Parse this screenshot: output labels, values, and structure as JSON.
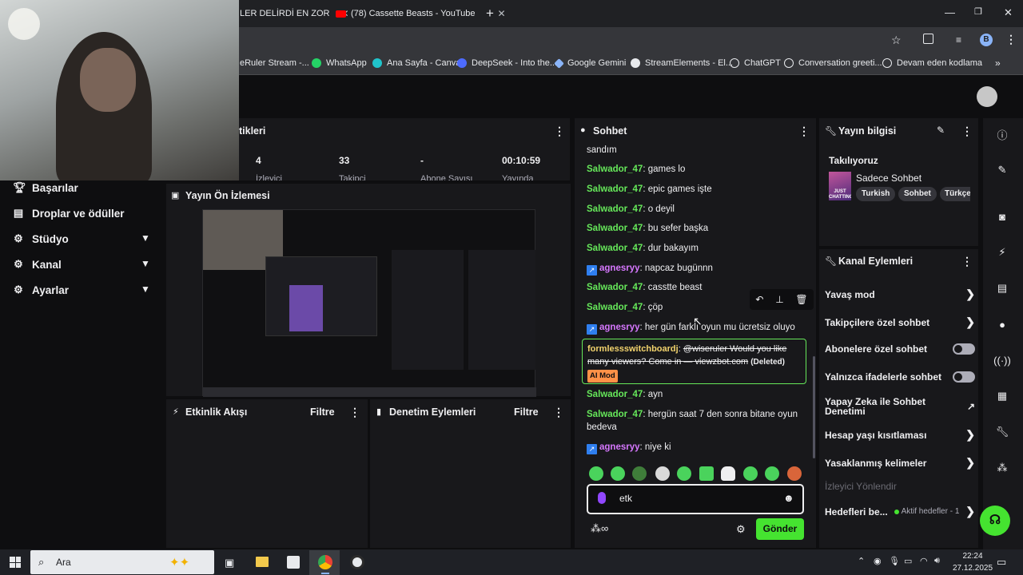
{
  "browser": {
    "tabs": [
      {
        "title": "LER DELİRDİ EN ZOR"
      },
      {
        "title": "(78) Cassette Beasts - YouTube"
      }
    ],
    "new_tab": "+",
    "bookmarks": [
      {
        "label": "eRuler Stream -..."
      },
      {
        "label": "WhatsApp"
      },
      {
        "label": "Ana Sayfa - Canva"
      },
      {
        "label": "DeepSeek - Into the..."
      },
      {
        "label": "Google Gemini"
      },
      {
        "label": "StreamElements - El..."
      },
      {
        "label": "ChatGPT"
      },
      {
        "label": "Conversation greeti..."
      },
      {
        "label": "Devam eden kodlama"
      }
    ],
    "profile_initial": "B"
  },
  "stats": {
    "title": "tikleri",
    "items": [
      {
        "value": "4",
        "label": "İzleyici"
      },
      {
        "value": "33",
        "label": "Takipçi"
      },
      {
        "value": "-",
        "label": "Abone Sayısı"
      },
      {
        "value": "00:10:59",
        "label": "Yayında"
      }
    ]
  },
  "nav": {
    "items": [
      {
        "label": "Başarılar",
        "icon": "trophy-icon"
      },
      {
        "label": "Droplar ve ödüller",
        "icon": "drops-icon"
      },
      {
        "label": "Stüdyo",
        "icon": "gear-icon"
      },
      {
        "label": "Kanal",
        "icon": "gear-icon"
      },
      {
        "label": "Ayarlar",
        "icon": "gear-icon"
      }
    ]
  },
  "preview": {
    "title": "Yayın Ön İzlemesi"
  },
  "activity": {
    "title": "Etkinlik Akışı",
    "filter": "Filtre"
  },
  "moderation": {
    "title": "Denetim Eylemleri",
    "filter": "Filtre"
  },
  "chat": {
    "title": "Sohbet",
    "messages": [
      {
        "user": "",
        "text": "sandım"
      },
      {
        "user": "Salwador_47",
        "text": "games lo"
      },
      {
        "user": "Salwador_47",
        "text": "epic games işte"
      },
      {
        "user": "Salwador_47",
        "text": "o deyil"
      },
      {
        "user": "Salwador_47",
        "text": "bu sefer başka"
      },
      {
        "user": "Salwador_47",
        "text": "dur bakayım"
      },
      {
        "user": "agnesryy",
        "text": "napcaz bugünnn"
      },
      {
        "user": "Salwador_47",
        "text": "casstte beast"
      },
      {
        "user": "Salwador_47",
        "text": "çöp"
      },
      {
        "user": "agnesryy",
        "text": "her gün farklı oyun mu ücretsiz oluyo"
      },
      {
        "user": "Salwador_47",
        "text": "ayn"
      },
      {
        "user": "Salwador_47",
        "text": "hergün saat 7 den sonra bitane oyun bedeva"
      },
      {
        "user": "agnesryy",
        "text": "niye ki"
      }
    ],
    "deleted_msg": {
      "user": "formlessswitchboardj",
      "text": "@wiseruler Would you like many viewers? Come in — viewzbot.com",
      "deleted_label": "(Deleted)",
      "aimod_label": "AI Mod"
    },
    "input_value": "etk",
    "send_label": "Gönder"
  },
  "stream_info": {
    "title": "Yayın bilgisi",
    "category_label": "Takılıyoruz",
    "category_name": "Sadece Sohbet",
    "tags": [
      "Turkish",
      "Sohbet",
      "Türkçe"
    ],
    "cover_text": "JUST CHATTING"
  },
  "channel_actions": {
    "title": "Kanal Eylemleri",
    "items": [
      {
        "label": "Yavaş mod"
      },
      {
        "label": "Takipçilere özel sohbet"
      },
      {
        "label": "Abonelere özel sohbet"
      },
      {
        "label": "Yalnızca ifadelerle sohbet"
      },
      {
        "label": "Yapay Zeka ile Sohbet Denetimi"
      },
      {
        "label": "Hesap yaşı kısıtlaması"
      },
      {
        "label": "Yasaklanmış kelimeler"
      },
      {
        "label": "İzleyici Yönlendir"
      },
      {
        "label": "Hedefleri be..."
      }
    ],
    "goal_status": "Aktif hedefler - 1"
  },
  "taskbar": {
    "search_label": "Ara",
    "time": "22:24",
    "date": "27.12.2025"
  }
}
